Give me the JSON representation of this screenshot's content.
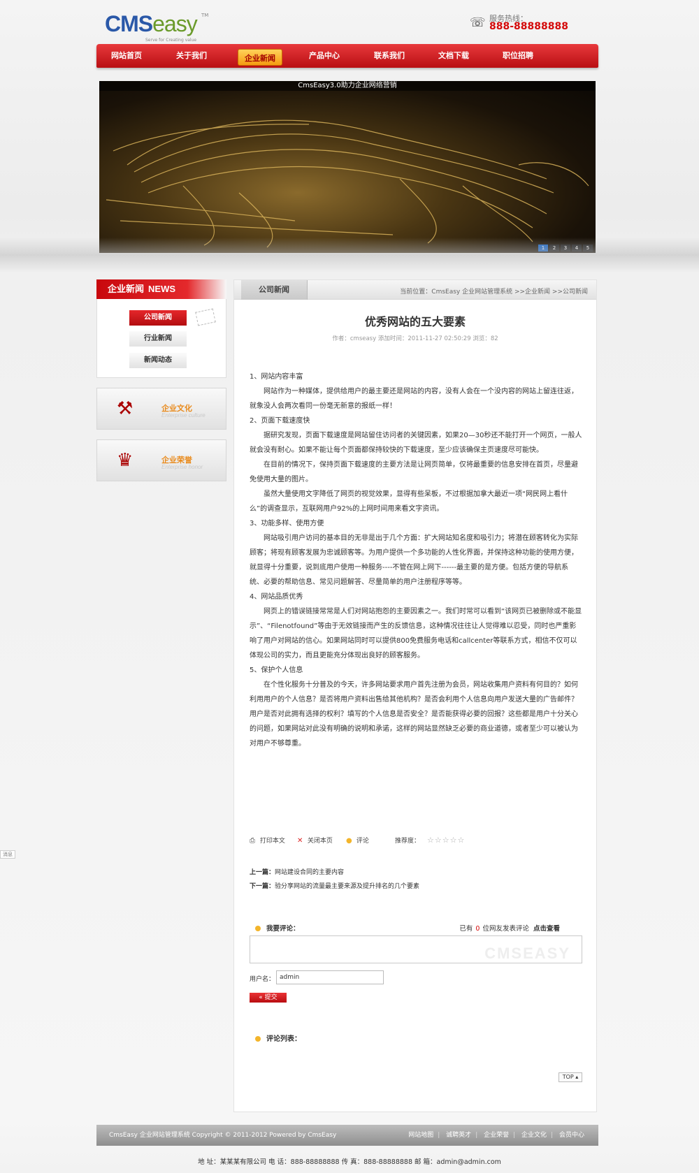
{
  "header": {
    "logo_brand_a": "CMS",
    "logo_brand_b": "easy",
    "logo_tm": "TM",
    "logo_slogan": "Serve for Creating value",
    "hotline_label": "服务热线：",
    "hotline_number": "888-88888888"
  },
  "nav": {
    "items": [
      "网站首页",
      "关于我们",
      "企业新闻",
      "产品中心",
      "联系我们",
      "文档下载",
      "职位招聘"
    ],
    "active": "企业新闻"
  },
  "banner": {
    "caption": "CmsEasy3.0助力企业网络营销",
    "dots": [
      "1",
      "2",
      "3",
      "4",
      "5"
    ]
  },
  "sidebar": {
    "title_cn": "企业新闻",
    "title_en": "NEWS",
    "menu": [
      "公司新闻",
      "行业新闻",
      "新闻动态"
    ],
    "boxes": [
      {
        "title": "企业文化",
        "sub": "Enterprise culture"
      },
      {
        "title": "企业荣誉",
        "sub": "Enterprise honor"
      }
    ]
  },
  "main": {
    "tab": "公司新闻",
    "breadcrumb": "当前位置：CmsEasy 企业网站管理系统 >>企业新闻 >>公司新闻",
    "title": "优秀网站的五大要素",
    "meta": "作者：cmseasy   添加时间：2011-11-27 02:50:29   浏览：82",
    "paragraphs": [
      "1、网站内容丰富",
      "网站作为一种媒体，提供给用户的最主要还是网站的内容，没有人会在一个没内容的网站上留连往返，就象没人会两次看同一份毫无新意的报纸一样！",
      "2、页面下载速度快",
      "据研究发现，页面下载速度是网站留住访问者的关键因素，如果20—30秒还不能打开一个网页，一般人就会没有耐心。如果不能让每个页面都保持较快的下载速度，至少应该确保主页速度尽可能快。",
      "在目前的情况下，保持页面下载速度的主要方法是让网页简单，仅将最重要的信息安排在首页，尽量避免使用大量的图片。",
      "虽然大量使用文字降低了网页的视觉效果，显得有些呆板，不过根据加拿大最近一项“网民网上看什么”的调查显示，互联网用户92%的上网时间用来看文字资讯。",
      "3、功能多样、使用方便",
      "网站吸引用户访问的基本目的无非是出于几个方面：扩大网站知名度和吸引力；将潜在顾客转化为实际顾客；将现有顾客发展为忠诚顾客等。为用户提供一个多功能的人性化界面，并保持这种功能的使用方便，就显得十分重要，说到底用户使用一种服务----不管在网上网下------最主要的是方便。包括方便的导航系统、必要的帮助信息、常见问题解答、尽量简单的用户注册程序等等。",
      "4、网站品质优秀",
      "网页上的错误链接常常是人们对网站抱怨的主要因素之一。我们时常可以看到“该网页已被删除或不能显示”、“Filenotfound”等由于无效链接而产生的反馈信息，这种情况往往让人觉得难以忍受，同时也严重影响了用户对网站的信心。如果网站同时可以提供800免费服务电话和callcenter等联系方式，相信不仅可以体现公司的实力，而且更能充分体现出良好的顾客服务。",
      "5、保护个人信息",
      "在个性化服务十分普及的今天，许多网站要求用户首先注册为会员，网站收集用户资料有何目的？如何利用用户的个人信息？是否将用户资料出售给其他机构？是否会利用个人信息向用户发送大量的广告邮件？用户是否对此拥有选择的权利？填写的个人信息是否安全？是否能获得必要的回报？这些都是用户十分关心的问题，如果网站对此没有明确的说明和承诺，这样的网站显然缺乏必要的商业道德，或者至少可以被认为对用户不够尊重。"
    ],
    "actions": {
      "print": "打印本文",
      "close": "关闭本页",
      "comment": "评论",
      "rating_label": "推荐度：",
      "rating_stars": 0
    },
    "prev_label": "上一篇：",
    "prev_title": "网站建设合同的主要内容",
    "next_label": "下一篇：",
    "next_title": "验分享网站的流量最主要来源及提升排名的几个要素",
    "comment": {
      "heading": "我要评论：",
      "count_prefix": "已有",
      "count": "0",
      "count_suffix": "位网友发表评论",
      "view_link": "点击查看",
      "watermark": "CMSEASY",
      "user_label": "用户名：",
      "user_value": "admin",
      "submit": "提交",
      "list_heading": "评论列表：",
      "top": "TOP"
    }
  },
  "footer": {
    "copyright": "CmsEasy 企业网站管理系统  Copyright © 2011-2012  Powered by CmsEasy",
    "links": [
      "网站地图",
      "诚聘英才",
      "企业荣誉",
      "企业文化",
      "会员中心"
    ],
    "address": "地 址：某某某有限公司  电 话：888-88888888  传 真：888-88888888  邮 箱：admin@admin.com"
  },
  "side_tab": "消息"
}
